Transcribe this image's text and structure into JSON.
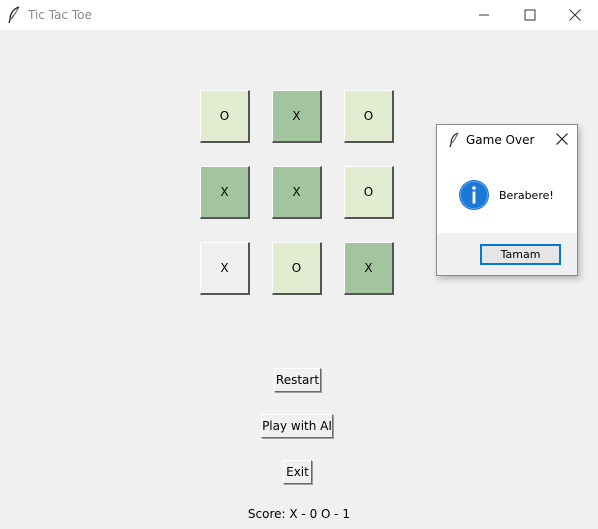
{
  "window": {
    "title": "Tic Tac Toe",
    "icon": "feather-icon",
    "controls": [
      "minimize-icon",
      "maximize-icon",
      "close-icon"
    ]
  },
  "board": {
    "cells": [
      {
        "label": "O",
        "color": "#e1ecd0"
      },
      {
        "label": "X",
        "color": "#a2c5a0"
      },
      {
        "label": "O",
        "color": "#e1ecd0"
      },
      {
        "label": "X",
        "color": "#a2c5a0"
      },
      {
        "label": "X",
        "color": "#a2c5a0"
      },
      {
        "label": "O",
        "color": "#e1ecd0"
      },
      {
        "label": "X",
        "color": "#f0f0f0"
      },
      {
        "label": "O",
        "color": "#e1ecd0"
      },
      {
        "label": "X",
        "color": "#a2c5a0"
      }
    ]
  },
  "buttons": {
    "restart": "Restart",
    "play_ai": "Play with AI",
    "exit": "Exit"
  },
  "score": "Score: X - 0 O - 1",
  "dialog": {
    "title": "Game Over",
    "message": "Berabere!",
    "ok_label": "Tamam",
    "icon": "info-icon",
    "accent": "#0078d7"
  }
}
